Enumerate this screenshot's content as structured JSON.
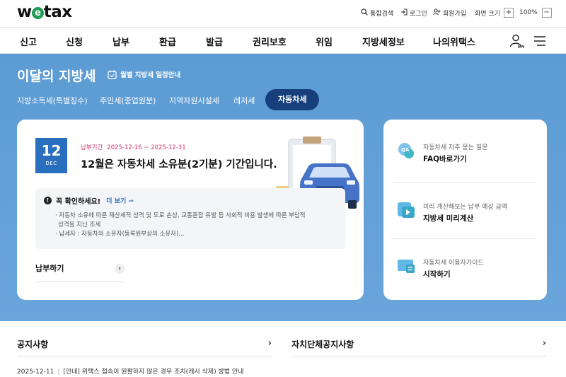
{
  "header": {
    "logo": "wetax",
    "utility": {
      "search": "통합검색",
      "login": "로그인",
      "signup": "회원가입",
      "screen_size": "화면 크기",
      "zoom_in": "+",
      "zoom_level": "100%",
      "zoom_out": "−"
    }
  },
  "nav": {
    "items": [
      "신고",
      "신청",
      "납부",
      "환급",
      "발급",
      "권리보호",
      "위임",
      "지방세정보",
      "나의위택스"
    ],
    "my_label": "MY"
  },
  "hero": {
    "title": "이달의 지방세",
    "schedule_link": "월별 지방세 일정안내",
    "tabs": [
      "지방소득세(특별징수)",
      "주민세(종업원분)",
      "지역자원시설세",
      "레저세",
      "자동차세"
    ],
    "active_tab": "자동차세"
  },
  "feature": {
    "date_day": "12",
    "date_month": "DEC",
    "period_label": "납부기간",
    "period_value": "2025-12-16 ~ 2025-12-31",
    "headline": "12월은 자동차세 소유분(2기분) 기간입니다.",
    "notice_title": "꼭 확인하세요!",
    "notice_more": "더 보기",
    "notice_lines": [
      "· 자동차 소유에 따른 재산세적 성격 및 도로 손상, 교통혼잡 유발 등 사회적 비용 발생에 따른 부담적",
      "성격을 지닌 조세",
      "· 납세자 : 자동차의 소유자(등록원부상의 소유자)…"
    ],
    "pay_link": "납부하기"
  },
  "side": [
    {
      "sub": "자동차세 자주 묻는 질문",
      "main": "FAQ바로가기",
      "icon": "qa-icon"
    },
    {
      "sub": "미리 계산해보는 납부 예상 금액",
      "main": "지방세 미리계산",
      "icon": "calculator-icon"
    },
    {
      "sub": "자동차세 이용자가이드",
      "main": "시작하기",
      "icon": "guide-icon"
    }
  ],
  "notices": {
    "left_title": "공지사항",
    "right_title": "자치단체공지사항",
    "first_date": "2025-12-11",
    "first_title": "[안내] 위택스 접속이 원활하지 않은 경우 조치(캐시 삭제) 방법 안내"
  },
  "colors": {
    "hero_bg": "#5c9bd3",
    "active_tab": "#173f7c",
    "date_box": "#2a6ebe",
    "period_text": "#d6336c",
    "logo_accent": "#1f9d55"
  }
}
